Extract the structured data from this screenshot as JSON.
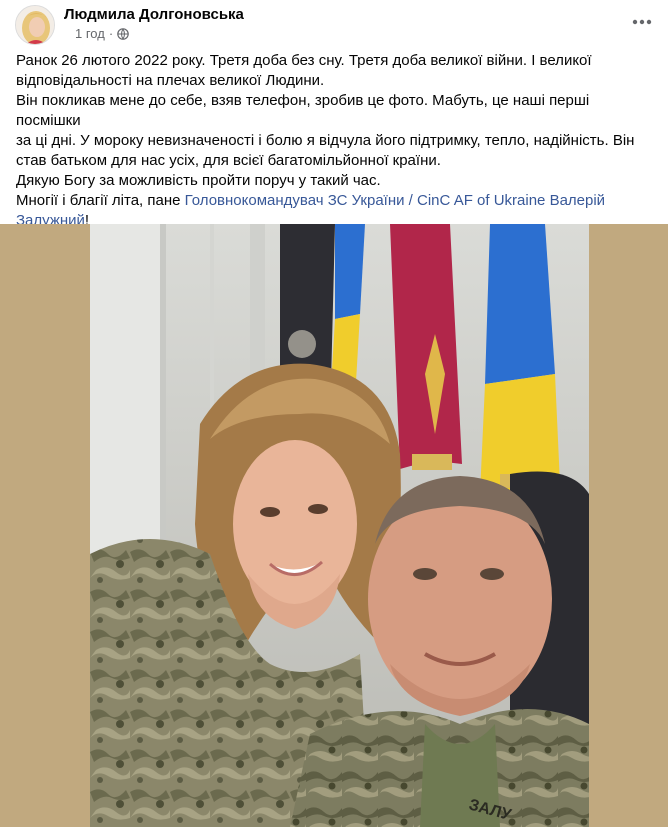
{
  "post": {
    "author": "Людмила Долгоновська",
    "timestamp": "1 год",
    "privacy_icon": "globe-icon",
    "more_icon": "more-horizontal-icon",
    "lines": [
      "Ранок 26 лютого 2022 року. Третя доба без сну. Третя доба великої війни. І великої",
      "відповідальності на плечах великої Людини.",
      "Він покликав мене до себе, взяв телефон, зробив це фото. Мабуть, це наші перші посмішки",
      "за ці дні. У мороку невизначеності і болю я відчула його підтримку, тепло, надійність. Він",
      "став батьком для нас усіх, для всієї багатомільйонної країни.",
      "Дякую Богу за можливість пройти поруч у такий час."
    ],
    "last_line_prefix": "Многії і благії літа, пане ",
    "mention_part1": "Головнокомандувач ЗС України / CinC AF of Ukraine Валерій",
    "mention_part2": "Залужний",
    "last_line_suffix": "!",
    "photo_description": "selfie-photo",
    "uniform_label": "ЗАЛУ"
  },
  "colors": {
    "link": "#385898",
    "meta": "#65676b",
    "photo_frame": "#c1a97f"
  }
}
